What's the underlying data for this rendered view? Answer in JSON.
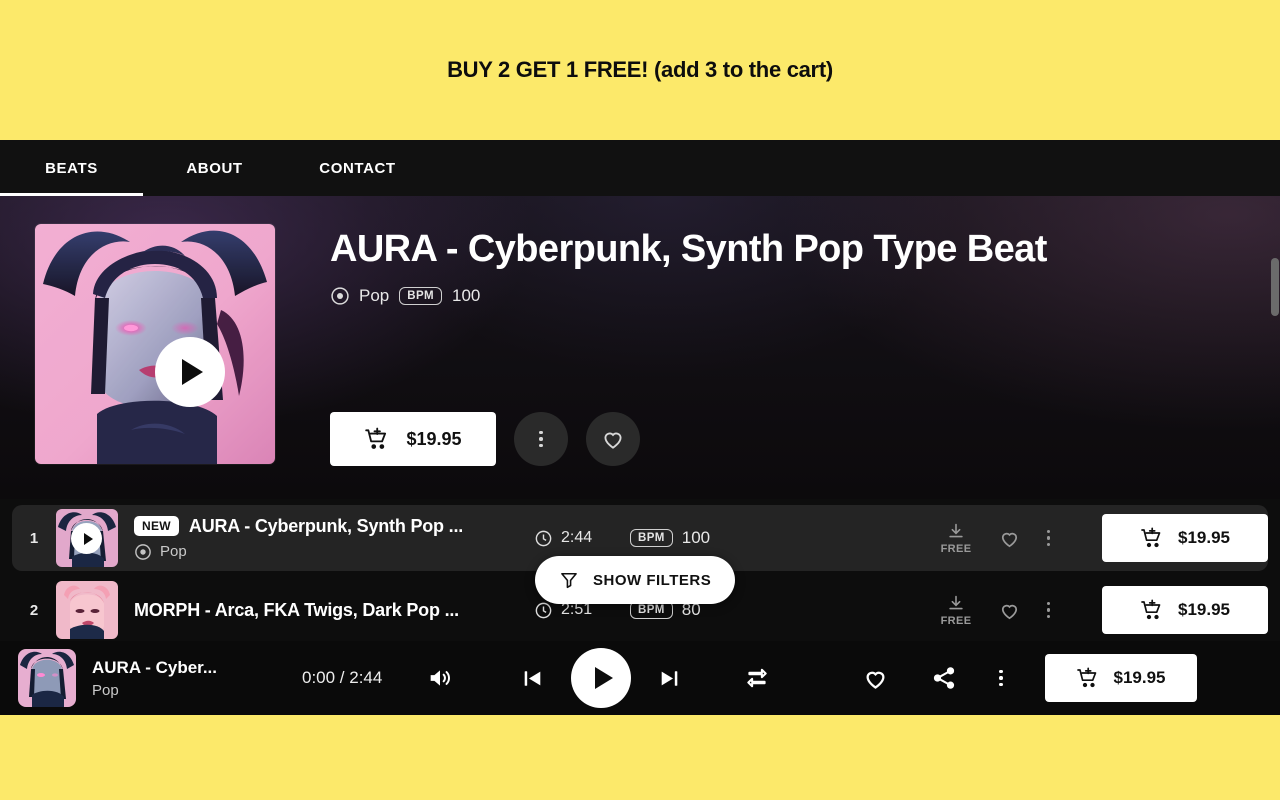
{
  "promo": {
    "text": "BUY 2 GET 1 FREE! (add 3 to the cart)",
    "bg": "#fce96a"
  },
  "nav": {
    "items": [
      {
        "label": "BEATS",
        "active": true
      },
      {
        "label": "ABOUT",
        "active": false
      },
      {
        "label": "CONTACT",
        "active": false
      }
    ]
  },
  "hero": {
    "title": "AURA - Cyberpunk, Synth Pop Type Beat",
    "genre": "Pop",
    "bpm_label": "BPM",
    "bpm": "100",
    "price": "$19.95",
    "icons": {
      "play": "play-icon",
      "cart": "add-to-cart-icon",
      "more": "more-options-icon",
      "favorite": "heart-icon",
      "genre": "genre-disc-icon"
    }
  },
  "beats": {
    "rows": [
      {
        "num": "1",
        "badge": "NEW",
        "title": "AURA - Cyberpunk, Synth Pop ...",
        "genre": "Pop",
        "duration": "2:44",
        "bpm_label": "BPM",
        "bpm": "100",
        "free_label": "FREE",
        "price": "$19.95",
        "selected": true
      },
      {
        "num": "2",
        "badge": "",
        "title": "MORPH - Arca, FKA Twigs, Dark Pop ...",
        "genre": "",
        "duration": "2:51",
        "bpm_label": "BPM",
        "bpm": "80",
        "free_label": "FREE",
        "price": "$19.95",
        "selected": false
      }
    ]
  },
  "filters": {
    "label": "SHOW FILTERS",
    "icon": "filter-funnel-icon"
  },
  "player": {
    "title": "AURA - Cyber...",
    "subtitle": "Pop",
    "current_time": "0:00",
    "total_time": "2:44",
    "time_display": "0:00 / 2:44",
    "price": "$19.95",
    "icons": {
      "volume": "volume-icon",
      "previous": "skip-previous-icon",
      "play": "play-icon",
      "next": "skip-next-icon",
      "repeat": "repeat-icon",
      "favorite": "heart-icon",
      "share": "share-icon",
      "more": "more-options-icon",
      "cart": "add-to-cart-icon"
    }
  },
  "colors": {
    "brand_yellow": "#fce96a",
    "page_dark": "#0d0d0d",
    "nav_dark": "#111111",
    "row_selected": "#242424",
    "white": "#ffffff"
  }
}
